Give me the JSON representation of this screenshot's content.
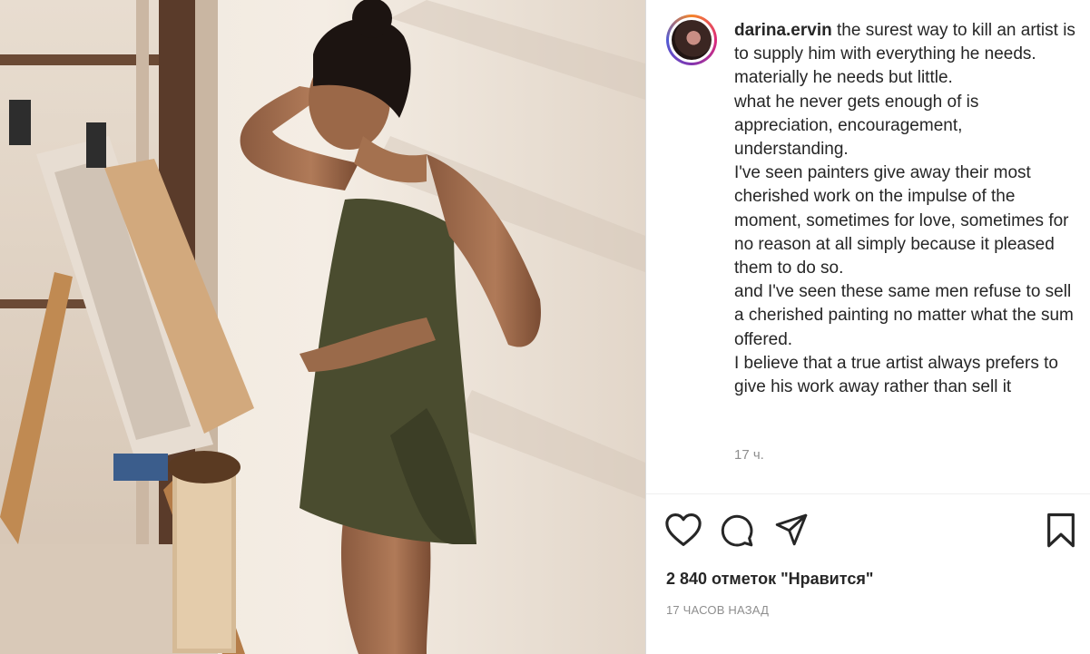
{
  "post": {
    "username": "darina.ervin",
    "caption_lines": [
      "the surest way to kill an artist is to supply him with everything he needs.",
      "materially he needs but little.",
      "what he never gets enough of is appreciation, encouragement, understanding.",
      "I've seen painters give away their most cherished work on the impulse of the moment, sometimes for love, sometimes for no reason at all simply because it pleased them to do so.",
      "and I've seen these same men refuse to sell a cherished painting no matter what the sum offered.",
      "I believe that a true artist always prefers to give his work away rather than sell it"
    ],
    "caption_time": "17 ч.",
    "likes_text": "2 840 отметок \"Нравится\"",
    "posted_ago": "17 ЧАСОВ НАЗАД"
  },
  "icons": {
    "like": "heart-icon",
    "comment": "comment-icon",
    "share": "share-icon",
    "save": "bookmark-icon",
    "avatar": "avatar"
  },
  "colors": {
    "text": "#262626",
    "muted": "#8e8e8e",
    "divider": "#efefef"
  }
}
